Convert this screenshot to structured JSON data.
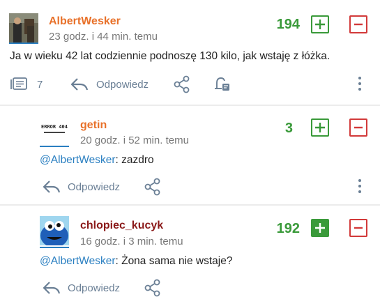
{
  "comments": [
    {
      "username": "AlbertWesker",
      "username_color": "#e8712a",
      "time": "23 godz. i 44 min. temu",
      "score": "194",
      "text": "Ja w wieku 42 lat codziennie podnoszę 130 kilo, jak wstaję z łóżka.",
      "replies_count": "7",
      "reply_label": "Odpowiedz"
    },
    {
      "username": "getin",
      "username_color": "#e8712a",
      "time": "20 godz. i 52 min. temu",
      "score": "3",
      "mention": "@AlbertWesker",
      "text": ": zazdro",
      "reply_label": "Odpowiedz",
      "avatar_text": "ERROR 404"
    },
    {
      "username": "chlopiec_kucyk",
      "username_color": "#8b1a1a",
      "time": "16 godz. i 3 min. temu",
      "score": "192",
      "mention": "@AlbertWesker",
      "text": ": Żona sama nie wstaje?",
      "reply_label": "Odpowiedz"
    }
  ],
  "colors": {
    "plus": "#3a9a3a",
    "minus": "#d23a3a",
    "action": "#6a7f95",
    "mention": "#2a7fc1"
  }
}
